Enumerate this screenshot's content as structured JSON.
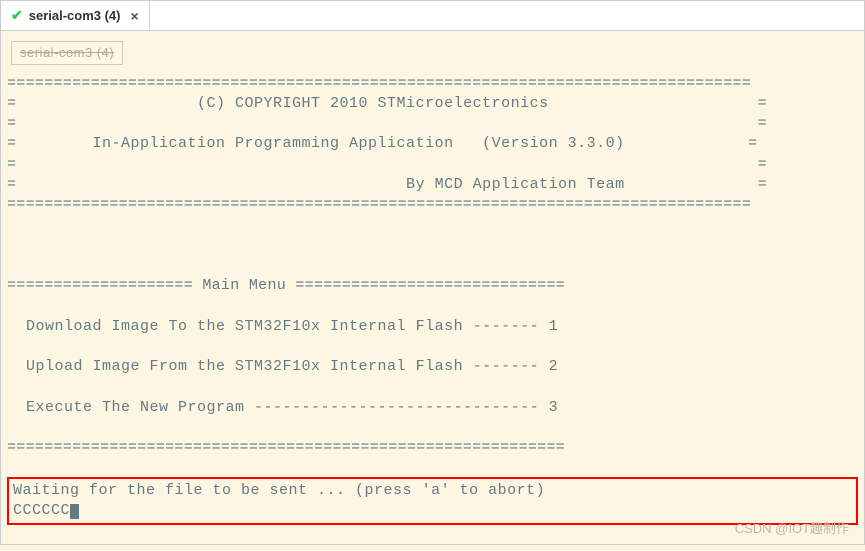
{
  "tab": {
    "title": "serial-com3 (4)",
    "icon": "check-icon",
    "close_label": "×"
  },
  "ghost_label": "serial-com3 (4)",
  "terminal": {
    "header_divider_top": "================================================================================",
    "copyright_line": "=                   (C) COPYRIGHT 2010 STMicroelectronics                      =",
    "blank_side1": "=                                                                              =",
    "app_line": "=        In-Application Programming Application   (Version 3.3.0)             =",
    "blank_side2": "=                                                                              =",
    "team_line": "=                                         By MCD Application Team              =",
    "header_divider_bot": "================================================================================",
    "menu_header": "==================== Main Menu =============================",
    "menu_item1": "  Download Image To the STM32F10x Internal Flash ------- 1",
    "menu_item2": "  Upload Image From the STM32F10x Internal Flash ------- 2",
    "menu_item3": "  Execute The New Program ------------------------------ 3",
    "menu_footer": "============================================================",
    "wait_line": "Waiting for the file to be sent ... (press 'a' to abort)",
    "echo_chars": "CCCCCC"
  },
  "watermark": "CSDN @IOT趣制作"
}
